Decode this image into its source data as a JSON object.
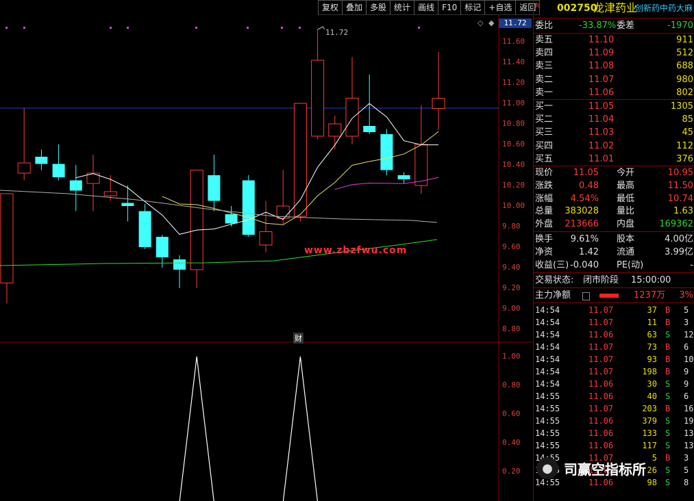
{
  "toolbar": [
    "复权",
    "叠加",
    "多股",
    "统计",
    "画线",
    "F10",
    "标记",
    "+自选",
    "返回"
  ],
  "chart": {
    "price_marker": "11.72",
    "high_label": "11.72",
    "watermark": "www.zbzfwu.com",
    "indicator_label": "财",
    "price_ticks": [
      "11.60",
      "11.40",
      "11.20",
      "11.00",
      "10.80",
      "10.60",
      "10.40",
      "10.20",
      "10.00",
      "9.80",
      "9.60",
      "9.40",
      "9.20",
      "9.00",
      "8.80"
    ],
    "indicator_ticks": [
      "1.00",
      "0.80",
      "0.60",
      "0.40",
      "0.20"
    ]
  },
  "chart_data": {
    "type": "candlestick",
    "ylim": [
      8.8,
      11.7
    ],
    "candles": [
      {
        "o": 9.25,
        "h": 10.1,
        "l": 9.05,
        "c": 10.12
      },
      {
        "o": 10.32,
        "h": 10.95,
        "l": 10.25,
        "c": 10.42
      },
      {
        "o": 10.48,
        "h": 10.55,
        "l": 10.35,
        "c": 10.41
      },
      {
        "o": 10.41,
        "h": 10.6,
        "l": 10.25,
        "c": 10.28
      },
      {
        "o": 10.25,
        "h": 10.4,
        "l": 9.95,
        "c": 10.15
      },
      {
        "o": 10.22,
        "h": 10.5,
        "l": 9.95,
        "c": 10.32
      },
      {
        "o": 10.1,
        "h": 10.3,
        "l": 10.05,
        "c": 10.14
      },
      {
        "o": 10.03,
        "h": 10.2,
        "l": 9.85,
        "c": 10.0
      },
      {
        "o": 9.95,
        "h": 10.02,
        "l": 9.58,
        "c": 9.6
      },
      {
        "o": 9.7,
        "h": 9.72,
        "l": 9.4,
        "c": 9.5
      },
      {
        "o": 9.48,
        "h": 9.52,
        "l": 9.2,
        "c": 9.38
      },
      {
        "o": 9.38,
        "h": 10.35,
        "l": 9.2,
        "c": 10.35
      },
      {
        "o": 10.3,
        "h": 10.5,
        "l": 9.95,
        "c": 10.05
      },
      {
        "o": 9.92,
        "h": 10.0,
        "l": 9.8,
        "c": 9.83
      },
      {
        "o": 10.25,
        "h": 10.3,
        "l": 9.7,
        "c": 9.72
      },
      {
        "o": 9.62,
        "h": 10.05,
        "l": 9.55,
        "c": 9.75
      },
      {
        "o": 9.88,
        "h": 10.35,
        "l": 9.82,
        "c": 10.0
      },
      {
        "o": 9.9,
        "h": 11.0,
        "l": 9.85,
        "c": 11.0
      },
      {
        "o": 10.68,
        "h": 11.72,
        "l": 10.65,
        "c": 11.42
      },
      {
        "o": 10.68,
        "h": 10.88,
        "l": 10.55,
        "c": 10.8
      },
      {
        "o": 10.68,
        "h": 11.45,
        "l": 10.6,
        "c": 11.05
      },
      {
        "o": 10.78,
        "h": 11.28,
        "l": 10.7,
        "c": 10.72
      },
      {
        "o": 10.7,
        "h": 10.75,
        "l": 10.3,
        "c": 10.35
      },
      {
        "o": 10.3,
        "h": 10.33,
        "l": 10.22,
        "c": 10.26
      },
      {
        "o": 10.2,
        "h": 10.98,
        "l": 10.12,
        "c": 10.6
      },
      {
        "o": 10.95,
        "h": 11.5,
        "l": 10.74,
        "c": 11.05
      }
    ],
    "indicator": {
      "peaks_at_candle": [
        11,
        17
      ],
      "ylim": [
        0,
        1.0
      ]
    }
  },
  "panel": {
    "code": "002750",
    "name": "龙津药业",
    "concept": "创新药中药大麻",
    "weibi_label": "委比",
    "weibi": "-33.87%",
    "weicha_label": "委差",
    "weicha": "-1970",
    "asks": [
      {
        "label": "卖五",
        "price": "11.10",
        "vol": "911"
      },
      {
        "label": "卖四",
        "price": "11.09",
        "vol": "512"
      },
      {
        "label": "卖三",
        "price": "11.08",
        "vol": "688"
      },
      {
        "label": "卖二",
        "price": "11.07",
        "vol": "980"
      },
      {
        "label": "卖一",
        "price": "11.06",
        "vol": "802"
      }
    ],
    "bids": [
      {
        "label": "买一",
        "price": "11.05",
        "vol": "1305"
      },
      {
        "label": "买二",
        "price": "11.04",
        "vol": "85"
      },
      {
        "label": "买三",
        "price": "11.03",
        "vol": "45"
      },
      {
        "label": "买四",
        "price": "11.02",
        "vol": "112"
      },
      {
        "label": "买五",
        "price": "11.01",
        "vol": "376"
      }
    ],
    "stats": [
      {
        "l1": "现价",
        "v1": "11.05",
        "l2": "今开",
        "v2": "10.95"
      },
      {
        "l1": "涨跌",
        "v1": "0.48",
        "l2": "最高",
        "v2": "11.50"
      },
      {
        "l1": "涨幅",
        "v1": "4.54%",
        "l2": "最低",
        "v2": "10.74"
      },
      {
        "l1": "总量",
        "v1": "383028",
        "l2": "量比",
        "v2": "1.63"
      },
      {
        "l1": "外盘",
        "v1": "213666",
        "l2": "内盘",
        "v2": "169362"
      }
    ],
    "stats2": [
      {
        "l1": "换手",
        "v1": "9.61%",
        "l2": "股本",
        "v2": "4.00亿"
      },
      {
        "l1": "净资",
        "v1": "1.42",
        "l2": "流通",
        "v2": "3.99亿"
      },
      {
        "l1": "收益(三)",
        "v1": "-0.040",
        "l2": "PE(动)",
        "v2": "-"
      }
    ],
    "trade_status_label": "交易状态:",
    "trade_status": "闭市阶段",
    "trade_time": "15:00:00",
    "main_net_label": "主力净额",
    "main_net": "1237万",
    "main_net_pct": "3%",
    "ticks": [
      {
        "t": "14:54",
        "p": "11.07",
        "v": "37",
        "s": "B",
        "n": "5"
      },
      {
        "t": "14:54",
        "p": "11.07",
        "v": "11",
        "s": "B",
        "n": "3"
      },
      {
        "t": "14:54",
        "p": "11.06",
        "v": "63",
        "s": "S",
        "n": "12"
      },
      {
        "t": "14:54",
        "p": "11.07",
        "v": "73",
        "s": "B",
        "n": "6"
      },
      {
        "t": "14:54",
        "p": "11.07",
        "v": "93",
        "s": "B",
        "n": "10"
      },
      {
        "t": "14:54",
        "p": "11.07",
        "v": "198",
        "s": "B",
        "n": "9"
      },
      {
        "t": "14:54",
        "p": "11.06",
        "v": "30",
        "s": "S",
        "n": "9"
      },
      {
        "t": "14:55",
        "p": "11.06",
        "v": "40",
        "s": "S",
        "n": "6"
      },
      {
        "t": "14:55",
        "p": "11.07",
        "v": "203",
        "s": "B",
        "n": "16"
      },
      {
        "t": "14:55",
        "p": "11.06",
        "v": "379",
        "s": "S",
        "n": "19"
      },
      {
        "t": "14:55",
        "p": "11.06",
        "v": "133",
        "s": "S",
        "n": "13"
      },
      {
        "t": "14:55",
        "p": "11.06",
        "v": "117",
        "s": "S",
        "n": "13"
      },
      {
        "t": "14:55",
        "p": "11.07",
        "v": "5",
        "s": "B",
        "n": "3"
      },
      {
        "t": "14:55",
        "p": "11.05",
        "v": "26",
        "s": "S",
        "n": "5"
      },
      {
        "t": "14:55",
        "p": "11.06",
        "v": "98",
        "s": "S",
        "n": "8"
      }
    ],
    "wechat_name": "司赢空指标所"
  },
  "colors": {
    "up": "#ff3b3b",
    "down": "#40ffff",
    "ma5": "#ffffff",
    "ma10": "#e8e060",
    "ma20": "#e040e0",
    "ma60": "#30e030",
    "ma_long": "#b0b0b0",
    "hline": "#2040c0"
  }
}
